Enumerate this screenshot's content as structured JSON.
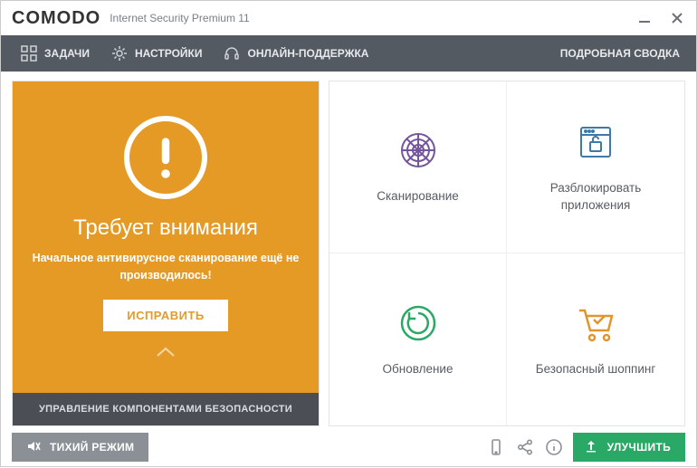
{
  "titlebar": {
    "brand": "COMODO",
    "subtitle": "Internet Security Premium 11"
  },
  "toolbar": {
    "tasks": "ЗАДАЧИ",
    "settings": "НАСТРОЙКИ",
    "support": "ОНЛАЙН-ПОДДЕРЖКА",
    "detailed": "ПОДРОБНАЯ СВОДКА"
  },
  "status": {
    "title": "Требует внимания",
    "subtitle": "Начальное антивирусное сканирование ещё не производилось!",
    "fix_label": "ИСПРАВИТЬ",
    "footer": "УПРАВЛЕНИЕ КОМПОНЕНТАМИ БЕЗОПАСНОСТИ"
  },
  "actions": {
    "scan": "Сканирование",
    "unblock": "Разблокировать приложения",
    "update": "Обновление",
    "shopping": "Безопасный шоппинг"
  },
  "bottom": {
    "silent": "ТИХИЙ РЕЖИМ",
    "upgrade": "УЛУЧШИТЬ"
  },
  "colors": {
    "warning": "#e59a26",
    "scan_icon": "#75559c",
    "unblock_icon": "#3d7aa8",
    "update_icon": "#2aa866",
    "shopping_icon": "#e0952e",
    "upgrade": "#2aa866"
  }
}
